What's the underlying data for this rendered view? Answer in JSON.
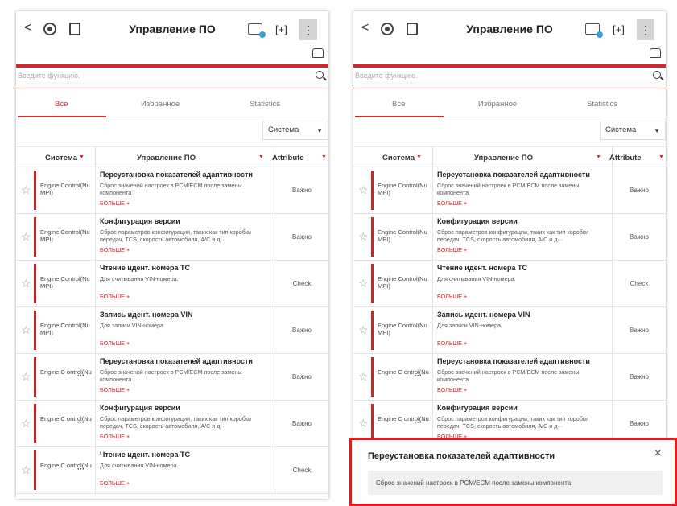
{
  "header": {
    "back_label": "<",
    "title": "Управление ПО",
    "menu_label": "⋮",
    "capture_label": "[+]"
  },
  "search": {
    "placeholder": "Введите функцию."
  },
  "tabs": [
    {
      "label": "Все",
      "active": true
    },
    {
      "label": "Избранное",
      "active": false
    },
    {
      "label": "Statistics",
      "active": false
    }
  ],
  "filter": {
    "selected": "Система",
    "caret": "▼"
  },
  "columns": {
    "system": "Система",
    "software": "Управление ПО",
    "attribute": "Attribute",
    "sort_caret": "▼"
  },
  "accent_color": "#d32f2f",
  "row_link_label": "БОЛЬШЕ +",
  "left_rows": [
    {
      "system": "Engine Control(Nu MPI)",
      "more": "",
      "title": "Переустановка показателей адаптивности",
      "desc": "Сброс значений настроек в PCM/ECM после замены компонента",
      "link": "БОЛЬШЕ +",
      "attr": "Важно"
    },
    {
      "system": "Engine Control(Nu MPI)",
      "more": "",
      "title": "Конфигурация версии",
      "desc": "Сброс параметров конфигурации, таких как тип коробки передач, TCS, скорость автомобиля, A/C и д···",
      "link": "БОЛЬШЕ +",
      "attr": "Важно"
    },
    {
      "system": "Engine Control(Nu MPI)",
      "more": "",
      "title": "Чтение идент. номера ТС",
      "desc": "Для считывания VIN-номера.",
      "link": "БОЛЬШЕ +",
      "attr": "Check"
    },
    {
      "system": "Engine Control(Nu MPI)",
      "more": "",
      "title": "Запись идент. номера VIN",
      "desc": "Для записи VIN-номера.",
      "link": "БОЛЬШЕ +",
      "attr": "Важно"
    },
    {
      "system": "Engine C ontrol(Nu",
      "more": "···",
      "title": "Переустановка показателей адаптивности",
      "desc": "Сброс значений настроек в PCM/ECM после замены компонента",
      "link": "БОЛЬШЕ +",
      "attr": "Важно"
    },
    {
      "system": "Engine C ontrol(Nu",
      "more": "···",
      "title": "Конфигурация версии",
      "desc": "Сброс параметров конфигурации, таких как тип коробки передач, TCS, скорость автомобиля, A/C и д···",
      "link": "БОЛЬШЕ +",
      "attr": "Важно"
    },
    {
      "system": "Engine C ontrol(Nu",
      "more": "···",
      "title": "Чтение идент. номера ТС",
      "desc": "Для считывания VIN-номера.",
      "link": "БОЛЬШЕ +",
      "attr": "Check"
    }
  ],
  "popup": {
    "title": "Переустановка показателей адаптивности",
    "close": "×",
    "body": "Сброс значений настроек в PCM/ECM после замены компонента"
  }
}
